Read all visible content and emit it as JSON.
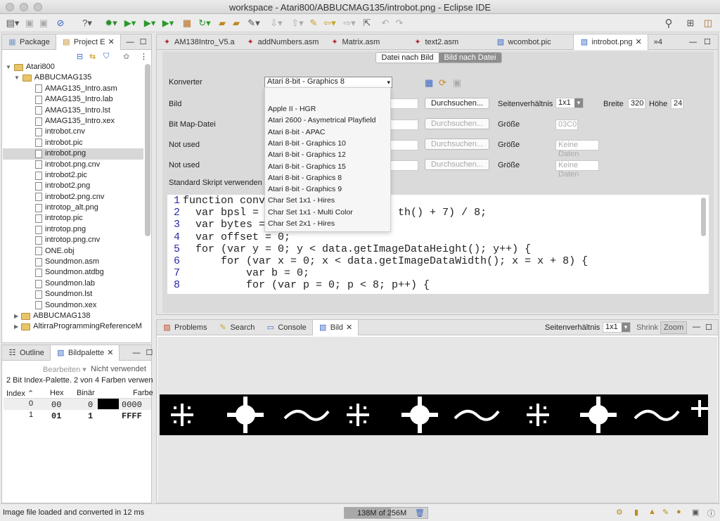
{
  "window": {
    "title": "workspace - Atari800/ABBUCMAG135/introbot.png - Eclipse IDE"
  },
  "left_tabs": {
    "package": "Package",
    "project": "Project E"
  },
  "tree": [
    {
      "label": "Atari800",
      "kind": "folder",
      "depth": 0,
      "sel": false
    },
    {
      "label": "ABBUCMAG135",
      "kind": "folder",
      "depth": 1,
      "sel": false
    },
    {
      "label": "AMAG135_Intro.asm",
      "kind": "file",
      "depth": 2,
      "sel": false
    },
    {
      "label": "AMAG135_Intro.lab",
      "kind": "file",
      "depth": 2,
      "sel": false
    },
    {
      "label": "AMAG135_Intro.lst",
      "kind": "file",
      "depth": 2,
      "sel": false
    },
    {
      "label": "AMAG135_Intro.xex",
      "kind": "file",
      "depth": 2,
      "sel": false
    },
    {
      "label": "introbot.cnv",
      "kind": "file",
      "depth": 2,
      "sel": false
    },
    {
      "label": "introbot.pic",
      "kind": "file",
      "depth": 2,
      "sel": false
    },
    {
      "label": "introbot.png",
      "kind": "file",
      "depth": 2,
      "sel": true
    },
    {
      "label": "introbot.png.cnv",
      "kind": "file",
      "depth": 2,
      "sel": false
    },
    {
      "label": "introbot2.pic",
      "kind": "file",
      "depth": 2,
      "sel": false
    },
    {
      "label": "introbot2.png",
      "kind": "file",
      "depth": 2,
      "sel": false
    },
    {
      "label": "introbot2.png.cnv",
      "kind": "file",
      "depth": 2,
      "sel": false
    },
    {
      "label": "introtop_alt.png",
      "kind": "file",
      "depth": 2,
      "sel": false
    },
    {
      "label": "introtop.pic",
      "kind": "file",
      "depth": 2,
      "sel": false
    },
    {
      "label": "introtop.png",
      "kind": "file",
      "depth": 2,
      "sel": false
    },
    {
      "label": "introtop.png.cnv",
      "kind": "file",
      "depth": 2,
      "sel": false
    },
    {
      "label": "ONE.obj",
      "kind": "file",
      "depth": 2,
      "sel": false
    },
    {
      "label": "Soundmon.asm",
      "kind": "file",
      "depth": 2,
      "sel": false
    },
    {
      "label": "Soundmon.atdbg",
      "kind": "file",
      "depth": 2,
      "sel": false
    },
    {
      "label": "Soundmon.lab",
      "kind": "file",
      "depth": 2,
      "sel": false
    },
    {
      "label": "Soundmon.lst",
      "kind": "file",
      "depth": 2,
      "sel": false
    },
    {
      "label": "Soundmon.xex",
      "kind": "file",
      "depth": 2,
      "sel": false
    },
    {
      "label": "ABBUCMAG138",
      "kind": "folder",
      "depth": 1,
      "sel": false
    },
    {
      "label": "AltirraProgrammingReferenceM",
      "kind": "folder",
      "depth": 1,
      "sel": false
    }
  ],
  "editor_tabs": [
    "AM138Intro_V5.a",
    "addNumbers.asm",
    "Matrix.asm",
    "text2.asm",
    "wcombot.pic",
    "introbot.png"
  ],
  "editor_tab_more": "»4",
  "mode_tabs": {
    "a": "Datei nach Bild",
    "b": "Bild nach Datei"
  },
  "form": {
    "konverter_label": "Konverter",
    "konverter_value": "Atari 8-bit - Graphics 8",
    "bild_label": "Bild",
    "bitmap_label": "Bit Map-Datei",
    "notused1": "Not used",
    "notused2": "Not used",
    "skript_label": "Standard Skript verwenden",
    "browse": "Durchsuchen...",
    "seitenv_label": "Seitenverhältnis",
    "seitenv_value": "1x1",
    "breite_label": "Breite",
    "breite_value": "320",
    "hoehe_label": "Höhe",
    "hoehe_value": "24",
    "groesse_label": "Größe",
    "groesse_value": "03C0",
    "keine_daten": "Keine Daten"
  },
  "dropdown": [
    "Apple II - HGR",
    "Atari 2600 - Asymetrical Playfield",
    "Atari 8-bit - APAC",
    "Atari 8-bit - Graphics 10",
    "Atari 8-bit - Graphics 12",
    "Atari 8-bit - Graphics 15",
    "Atari 8-bit - Graphics 8",
    "Atari 8-bit - Graphics 9",
    "Char Set 1x1 - Hires",
    "Char Set 1x1 - Multi Color",
    "Char Set 2x1 - Hires"
  ],
  "code": [
    {
      "n": "1",
      "t": "function conve"
    },
    {
      "n": "2",
      "t": "  var bpsl = (                    th() + 7) / 8;"
    },
    {
      "n": "3",
      "t": "  var bytes = "
    },
    {
      "n": "4",
      "t": "  var offset = 0;"
    },
    {
      "n": "5",
      "t": "  for (var y = 0; y < data.getImageDataHeight(); y++) {"
    },
    {
      "n": "6",
      "t": "      for (var x = 0; x < data.getImageDataWidth(); x = x + 8) {"
    },
    {
      "n": "7",
      "t": "          var b = 0;"
    },
    {
      "n": "8",
      "t": "          for (var p = 0; p < 8; p++) {"
    }
  ],
  "bottom_tabs": {
    "problems": "Problems",
    "search": "Search",
    "console": "Console",
    "bild": "Bild"
  },
  "bild_view": {
    "seitenv_label": "Seitenverhältnis",
    "seitenv_value": "1x1",
    "shrink": "Shrink",
    "zoom": "Zoom"
  },
  "palette": {
    "outline": "Outline",
    "tab": "Bildpalette",
    "bearbeiten": "Bearbeiten",
    "nicht": "Nicht verwendet",
    "info": "2 Bit Index-Palette. 2 von 4 Farben verwen",
    "cols": [
      "Index",
      "Hex",
      "Binär",
      "Farbe"
    ],
    "rows": [
      {
        "index": "0",
        "hex": "00",
        "bin": "0",
        "farbe": "0000"
      },
      {
        "index": "1",
        "hex": "01",
        "bin": "1",
        "farbe": "FFFF"
      }
    ]
  },
  "status": {
    "message": "Image file loaded and converted in 12 ms",
    "memory": "138M of 256M"
  }
}
